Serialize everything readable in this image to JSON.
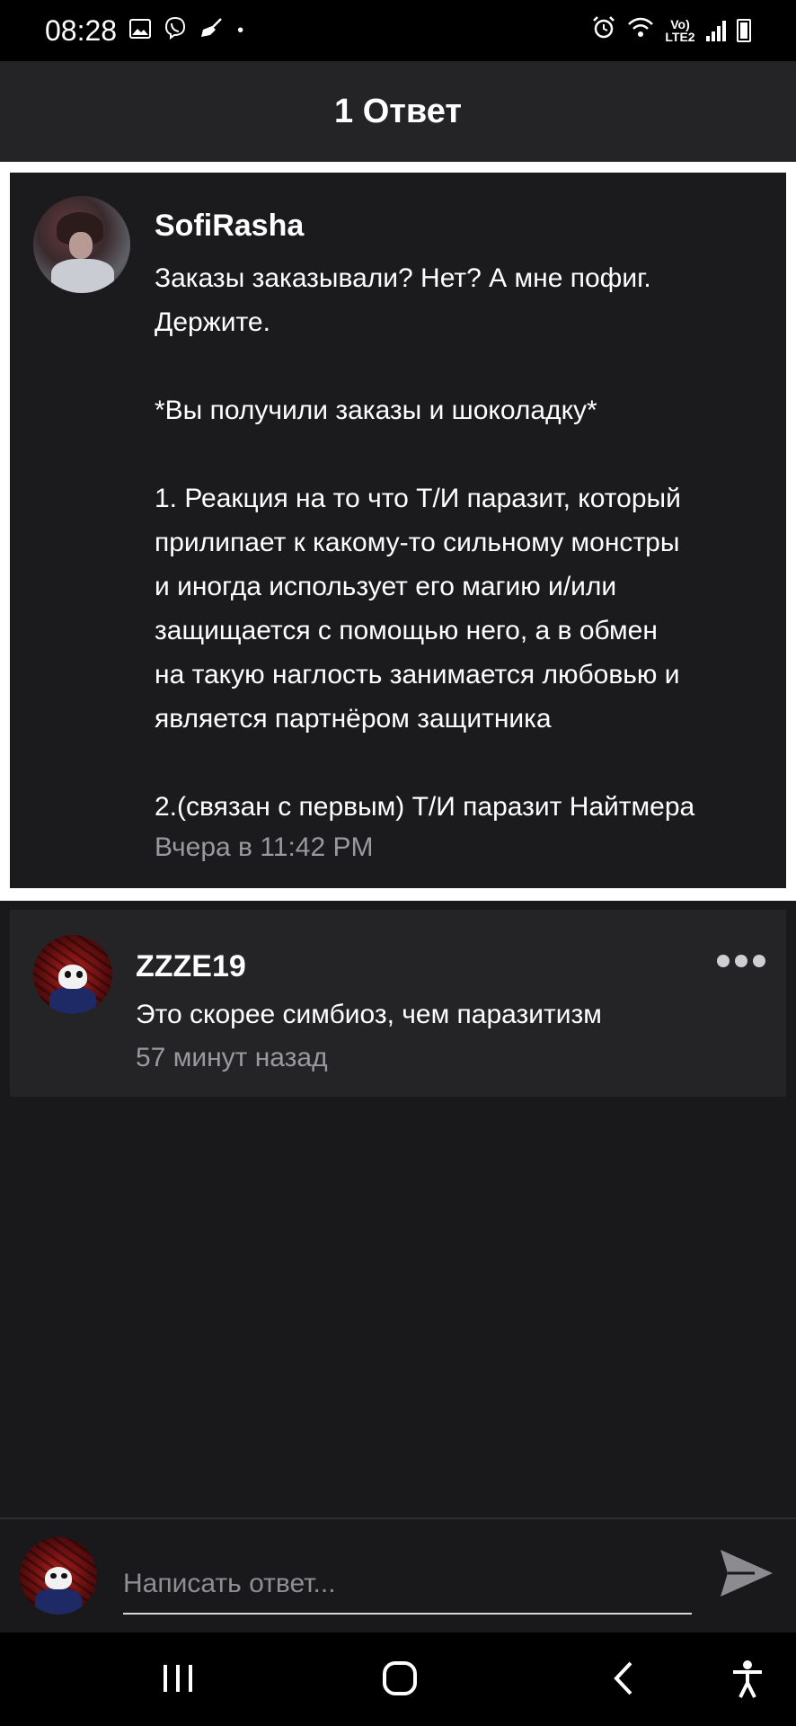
{
  "status_bar": {
    "time": "08:28",
    "network_label": "Vo) LTE2"
  },
  "header": {
    "title": "1 Ответ"
  },
  "post": {
    "author": "SofiRasha",
    "lines": [
      "Заказы заказывали? Нет? А мне пофиг.",
      "Держите.",
      "",
      "*Вы получили заказы и шоколадку*",
      "",
      "1. Реакция на то что Т/И паразит, который",
      "прилипает к какому-то сильному монстры",
      "и иногда использует его магию и/или",
      "защищается с помощью него, а в обмен",
      "на такую наглость занимается любовью и",
      "является партнёром защитника",
      "",
      "2.(связан с первым) Т/И паразит Найтмера"
    ],
    "time": "Вчера в 11:42 PM"
  },
  "reply": {
    "author": "ZZZE19",
    "text": "Это скорее симбиоз, чем паразитизм",
    "time": "57 минут назад"
  },
  "composer": {
    "placeholder": "Написать ответ..."
  },
  "icons": {
    "gallery": "image-icon",
    "viber": "viber-icon",
    "broom": "broom-icon",
    "alarm": "alarm-icon",
    "wifi": "wifi-icon",
    "signal": "signal-icon",
    "battery": "battery-icon",
    "more": "more-dots-icon",
    "send": "send-icon",
    "recents": "recents-icon",
    "home": "home-icon",
    "back": "back-icon",
    "accessibility": "accessibility-icon"
  },
  "colors": {
    "background": "#19181b",
    "header": "#242326",
    "card": "#1b1a1d",
    "reply_card": "#242326",
    "muted_text": "#9a999d"
  }
}
